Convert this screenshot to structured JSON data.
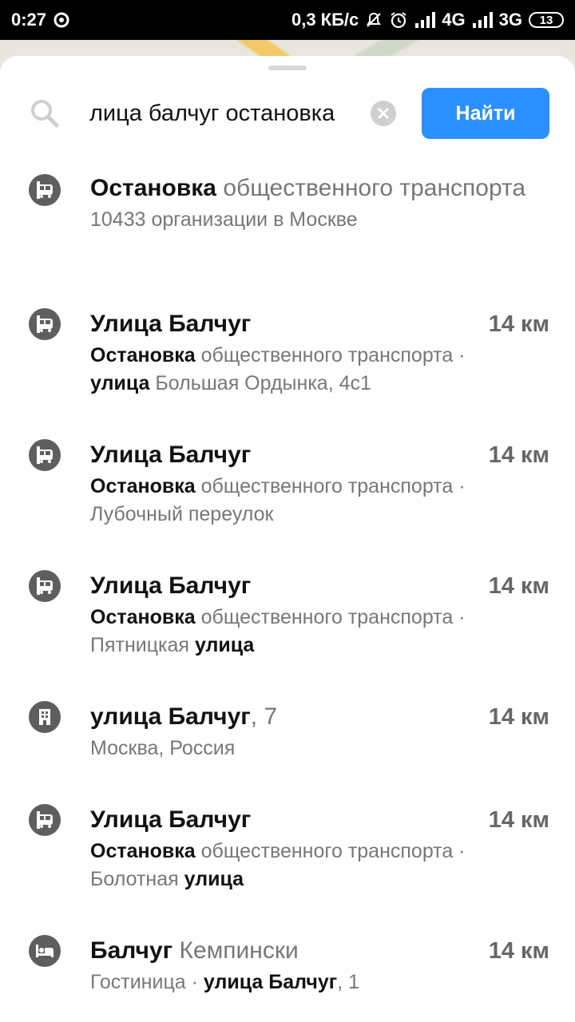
{
  "status_bar": {
    "time": "0:27",
    "net_speed": "0,3 КБ/с",
    "sim1": "4G",
    "sim2": "3G",
    "battery": "13"
  },
  "search": {
    "query": "лица балчуг остановка",
    "find_label": "Найти",
    "accent_color": "#2b8fff"
  },
  "results": [
    {
      "icon": "bus-stop-icon",
      "title_bold": "Остановка",
      "title_light": "общественного транспорта",
      "line1": "10433 организации в Москве"
    },
    {
      "icon": "bus-stop-icon",
      "title_bold": "Улица Балчуг",
      "distance": "14 км",
      "line1_bold": "Остановка",
      "line1_light": "общественного транспорта ·",
      "line2_bold": "улица",
      "line2_light": "Большая Ордынка, 4с1"
    },
    {
      "icon": "bus-stop-icon",
      "title_bold": "Улица Балчуг",
      "distance": "14 км",
      "line1_bold": "Остановка",
      "line1_light": "общественного транспорта ·",
      "line2_light": "Лубочный переулок"
    },
    {
      "icon": "bus-stop-icon",
      "title_bold": "Улица Балчуг",
      "distance": "14 км",
      "line1_bold": "Остановка",
      "line1_light": "общественного транспорта ·",
      "line2_light": "Пятницкая",
      "line2_bold": "улица"
    },
    {
      "icon": "building-icon",
      "title_bold": "улица Балчуг",
      "title_light": ", 7",
      "distance": "14 км",
      "line1": "Москва, Россия"
    },
    {
      "icon": "bus-stop-icon",
      "title_bold": "Улица Балчуг",
      "distance": "14 км",
      "line1_bold": "Остановка",
      "line1_light": "общественного транспорта ·",
      "line2_light": "Болотная",
      "line2_bold": "улица"
    },
    {
      "icon": "hotel-icon",
      "title_bold": "Балчуг",
      "title_light": "Кемпински",
      "distance": "14 км",
      "line1_light": "Гостиница ·",
      "line1_bold": "улица Балчуг",
      "line1_tail": ", 1"
    }
  ]
}
